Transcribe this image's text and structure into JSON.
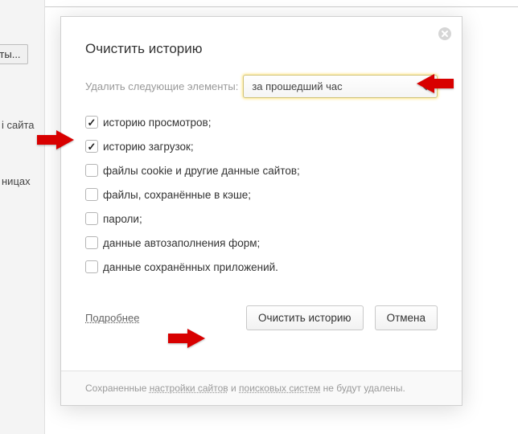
{
  "bg": {
    "buttonPartial": "фты...",
    "text1": "і сайта",
    "text2": "ницах"
  },
  "dialog": {
    "title": "Очистить историю",
    "deleteLabel": "Удалить следующие элементы:",
    "select": {
      "selected": "за прошедший час"
    },
    "items": [
      {
        "label": "историю просмотров;",
        "checked": true
      },
      {
        "label": "историю загрузок;",
        "checked": true
      },
      {
        "label": "файлы cookie и другие данные сайтов;",
        "checked": false
      },
      {
        "label": "файлы, сохранённые в кэше;",
        "checked": false
      },
      {
        "label": "пароли;",
        "checked": false
      },
      {
        "label": "данные автозаполнения форм;",
        "checked": false
      },
      {
        "label": "данные сохранённых приложений.",
        "checked": false
      }
    ],
    "more": "Подробнее",
    "clearBtn": "Очистить историю",
    "cancelBtn": "Отмена",
    "footer": {
      "p1": "Сохраненные ",
      "l1": "настройки сайтов",
      "p2": " и ",
      "l2": "поисковых систем",
      "p3": " не будут удалены."
    }
  },
  "colors": {
    "arrow": "#d80000"
  }
}
